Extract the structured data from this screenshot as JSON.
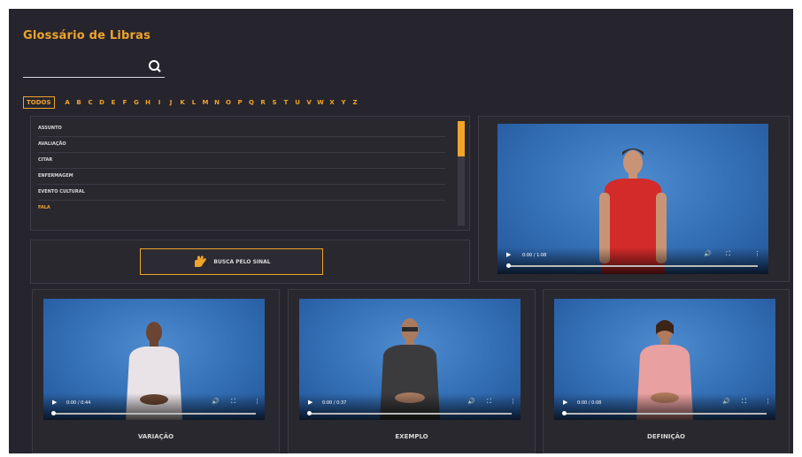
{
  "app": {
    "title": "Glossário de Libras"
  },
  "alphabet": {
    "all_label": "TODOS",
    "letters": [
      "A",
      "B",
      "C",
      "D",
      "E",
      "F",
      "G",
      "H",
      "I",
      "J",
      "K",
      "L",
      "M",
      "N",
      "O",
      "P",
      "Q",
      "R",
      "S",
      "T",
      "U",
      "V",
      "W",
      "X",
      "Y",
      "Z"
    ]
  },
  "word_list": {
    "items": [
      "ASSUNTO",
      "AVALIAÇÃO",
      "CITAR",
      "ENFERMAGEM",
      "EVENTO CULTURAL",
      "FALA"
    ],
    "active_index": 5
  },
  "sign_search": {
    "label": "BUSCA PELO SINAL"
  },
  "main_video": {
    "time": "0:00 / 1:08",
    "progress": 0.0
  },
  "bottom_videos": [
    {
      "caption": "VARIAÇÃO",
      "time": "0:00 / 0:44"
    },
    {
      "caption": "EXEMPLO",
      "time": "0:00 / 0:37"
    },
    {
      "caption": "DEFINIÇÃO",
      "time": "0:00 / 0:08"
    }
  ],
  "colors": {
    "accent": "#f0a42a",
    "background": "#26252d",
    "video_bg": "#336fb5"
  },
  "icons": [
    "search-icon",
    "hand-icon",
    "play-icon",
    "volume-icon",
    "fullscreen-icon",
    "more-vertical-icon"
  ]
}
